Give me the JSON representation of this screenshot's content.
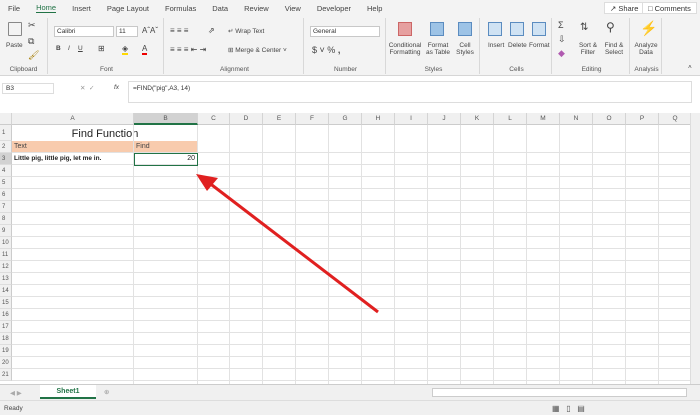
{
  "menu": {
    "tabs": [
      "File",
      "Home",
      "Insert",
      "Page Layout",
      "Formulas",
      "Data",
      "Review",
      "View",
      "Developer",
      "Help"
    ],
    "active": "Home",
    "share": "Share",
    "comments": "Comments"
  },
  "ribbon": {
    "clipboard": {
      "label": "Clipboard",
      "paste": "Paste"
    },
    "font": {
      "label": "Font",
      "name": "Calibri",
      "size": "11",
      "bold": "B",
      "italic": "I",
      "underline": "U"
    },
    "alignment": {
      "label": "Alignment",
      "wrap": "Wrap Text",
      "merge": "Merge & Center"
    },
    "number": {
      "label": "Number",
      "format": "General",
      "currency": "$",
      "percent": "%",
      "comma": ","
    },
    "styles": {
      "label": "Styles",
      "conditional": "Conditional Formatting",
      "format_table": "Format as Table",
      "cell_styles": "Cell Styles"
    },
    "cells": {
      "label": "Cells",
      "insert": "Insert",
      "delete": "Delete",
      "format": "Format"
    },
    "editing": {
      "label": "Editing",
      "sort": "Sort & Filter",
      "find": "Find & Select"
    },
    "analysis": {
      "label": "Analysis",
      "analyze": "Analyze Data"
    }
  },
  "formula_bar": {
    "name_box": "B3",
    "fx": "fx",
    "formula": "=FIND(\"pig\",A3, 14)"
  },
  "sheet": {
    "columns": [
      "A",
      "B",
      "C",
      "D",
      "E",
      "F",
      "G",
      "H",
      "I",
      "J",
      "K",
      "L",
      "M",
      "N",
      "O",
      "P",
      "Q"
    ],
    "rows": [
      "1",
      "2",
      "3",
      "4",
      "5",
      "6",
      "7",
      "8",
      "9",
      "10",
      "11",
      "12",
      "13",
      "14",
      "15",
      "16",
      "17",
      "18",
      "19",
      "20",
      "21"
    ],
    "title": "Find Function",
    "header_text": "Text",
    "header_find": "Find",
    "a3": "Little pig, little pig, let me in.",
    "b3": "20",
    "header_color": "#f8cbad",
    "arrow_color": "#e02020"
  },
  "sheet_tabs": {
    "active": "Sheet1"
  },
  "status": {
    "ready": "Ready"
  }
}
